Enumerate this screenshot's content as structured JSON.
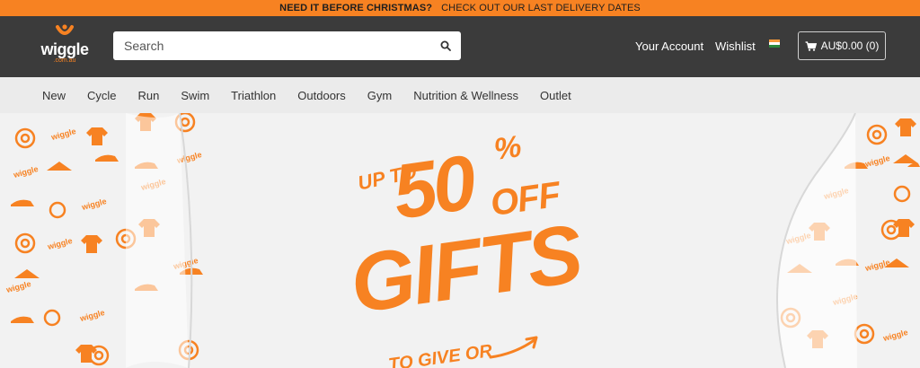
{
  "promo": {
    "headline": "NEED IT BEFORE CHRISTMAS?",
    "link": "CHECK OUT OUR LAST DELIVERY DATES"
  },
  "header": {
    "logo_text": "wiggle",
    "logo_sub": ".com.au",
    "search_placeholder": "Search",
    "account_label": "Your Account",
    "wishlist_label": "Wishlist",
    "flag_icon": "india-flag-icon",
    "basket_label": "AU$0.00 (0)"
  },
  "categories": [
    "New",
    "Cycle",
    "Run",
    "Swim",
    "Triathlon",
    "Outdoors",
    "Gym",
    "Nutrition & Wellness",
    "Outlet"
  ],
  "hero": {
    "up_to": "UP TO",
    "percent_value": "50",
    "percent_sign": "%",
    "off": "OFF",
    "gifts": "GIFTS",
    "to_give": "TO GIVE OR"
  },
  "colors": {
    "brand_orange": "#f78222",
    "header_dark": "#3b3b3b",
    "nav_grey": "#ebebeb"
  }
}
